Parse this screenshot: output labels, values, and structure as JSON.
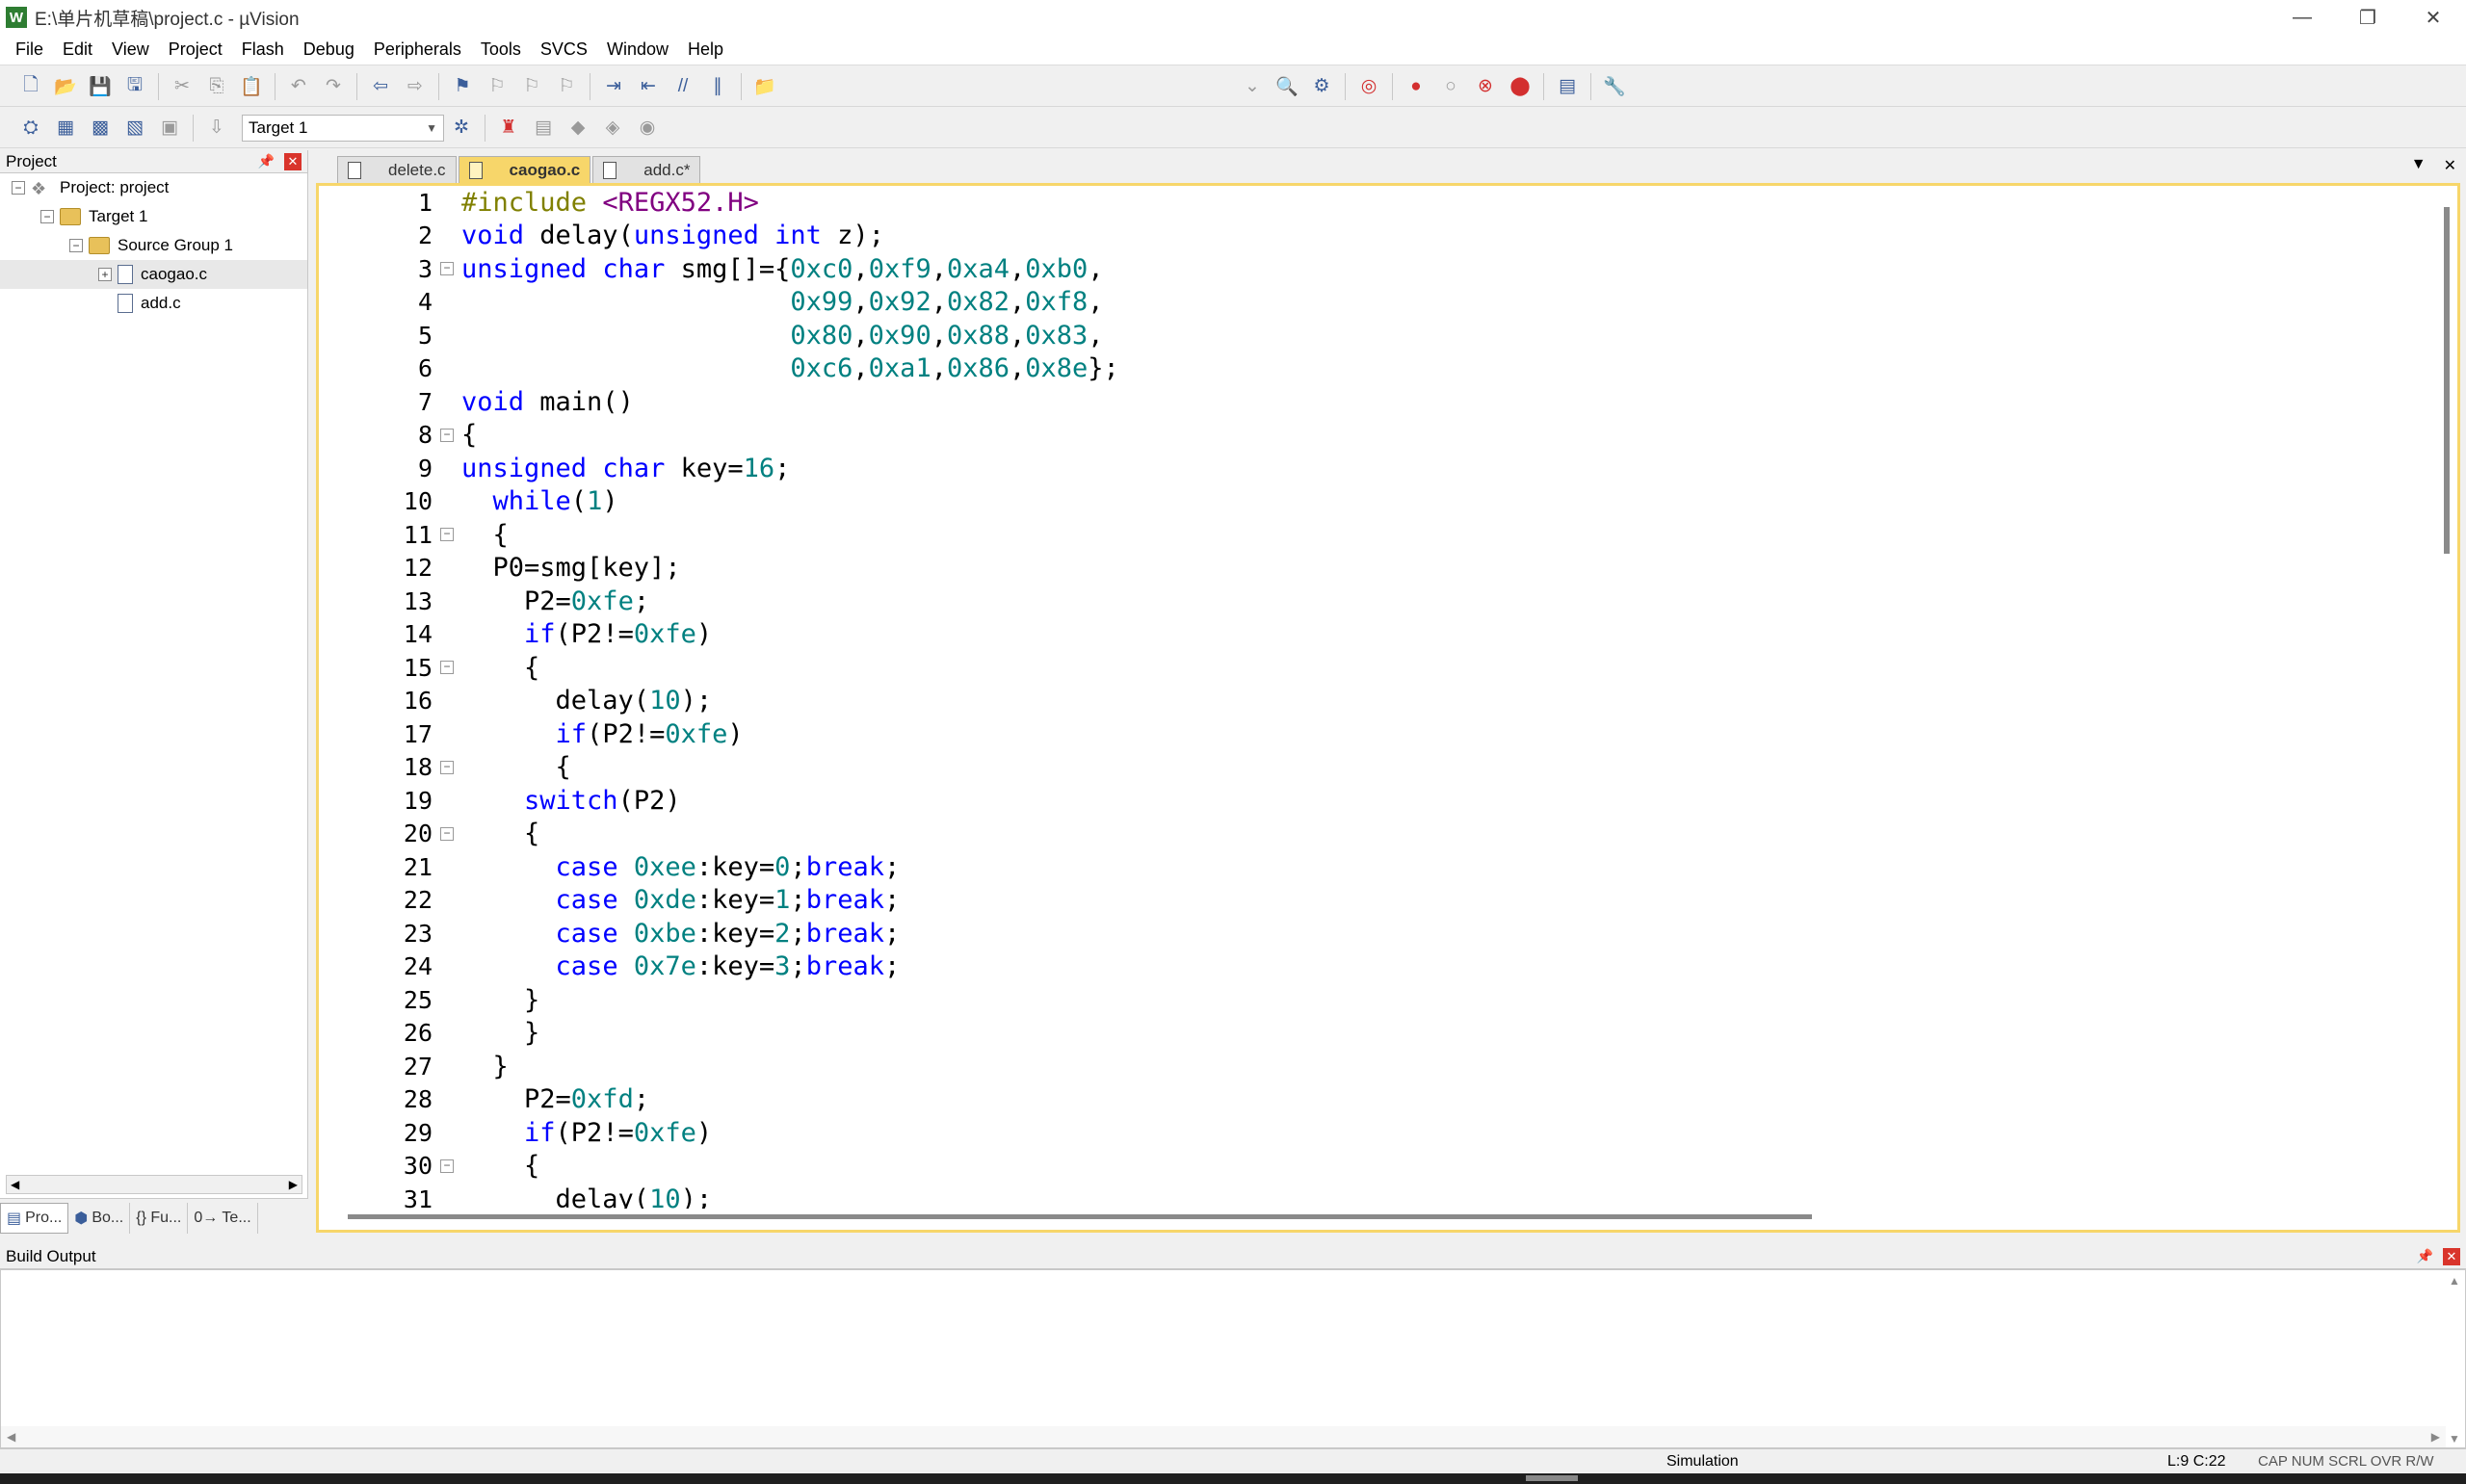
{
  "window": {
    "title": "E:\\单片机草稿\\project.c - µVision",
    "app_icon": "keil-icon",
    "controls": [
      "—",
      "❐",
      "✕"
    ]
  },
  "menu": [
    "File",
    "Edit",
    "View",
    "Project",
    "Flash",
    "Debug",
    "Peripherals",
    "Tools",
    "SVCS",
    "Window",
    "Help"
  ],
  "toolbar2": {
    "target": "Target 1"
  },
  "project_panel": {
    "title": "Project",
    "tree": {
      "project": "Project: project",
      "target": "Target 1",
      "group": "Source Group 1",
      "files": [
        "caogao.c",
        "add.c"
      ]
    },
    "tabs": [
      "Pro...",
      "Bo...",
      "{} Fu...",
      "0→ Te..."
    ]
  },
  "editor": {
    "tabs": [
      "delete.c",
      "caogao.c",
      "add.c*"
    ],
    "active_tab": "caogao.c",
    "lines": [
      "#include <REGX52.H>",
      "void delay(unsigned int z);",
      "unsigned char smg[]={0xc0,0xf9,0xa4,0xb0,",
      "                     0x99,0x92,0x82,0xf8,",
      "                     0x80,0x90,0x88,0x83,",
      "                     0xc6,0xa1,0x86,0x8e};",
      "void main()",
      "{",
      "unsigned char key=16;",
      "  while(1)",
      "  {",
      "  P0=smg[key];",
      "    P2=0xfe;",
      "    if(P2!=0xfe)",
      "    {",
      "      delay(10);",
      "      if(P2!=0xfe)",
      "      {",
      "    switch(P2)",
      "    {",
      "      case 0xee:key=0;break;",
      "      case 0xde:key=1;break;",
      "      case 0xbe:key=2;break;",
      "      case 0x7e:key=3;break;",
      "    }",
      "    }",
      "  }",
      "    P2=0xfd;",
      "    if(P2!=0xfe)",
      "    {",
      "      delay(10);"
    ]
  },
  "build_output": {
    "title": "Build Output"
  },
  "status": {
    "mode": "Simulation",
    "cursor": "L:9 C:22",
    "flags": "CAP  NUM  SCRL  OVR  R/W"
  }
}
